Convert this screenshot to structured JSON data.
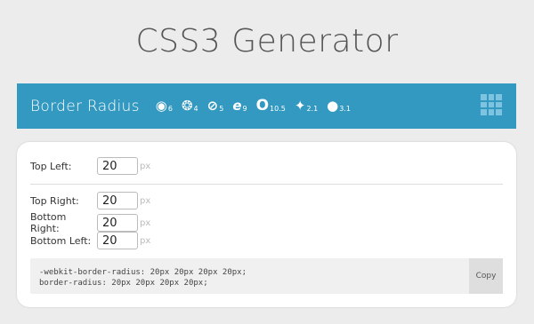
{
  "page": {
    "title": "CSS3 Generator"
  },
  "header": {
    "title": "Border Radius",
    "browsers": [
      {
        "icon": "chrome-icon",
        "glyph": "◉",
        "version": "6"
      },
      {
        "icon": "firefox-icon",
        "glyph": "❂",
        "version": "4"
      },
      {
        "icon": "safari-icon",
        "glyph": "⊘",
        "version": "5"
      },
      {
        "icon": "ie-icon",
        "glyph": "e",
        "version": "9"
      },
      {
        "icon": "opera-icon",
        "glyph": "O",
        "version": "10.5"
      },
      {
        "icon": "android-icon",
        "glyph": "✦",
        "version": "2.1"
      },
      {
        "icon": "apple-icon",
        "glyph": "●",
        "version": "3.1"
      }
    ]
  },
  "fields": {
    "top_left": {
      "label": "Top Left:",
      "value": "20",
      "unit": "px"
    },
    "top_right": {
      "label": "Top Right:",
      "value": "20",
      "unit": "px"
    },
    "bottom_right": {
      "label": "Bottom Right:",
      "value": "20",
      "unit": "px"
    },
    "bottom_left": {
      "label": "Bottom Left:",
      "value": "20",
      "unit": "px"
    }
  },
  "output": {
    "line1": "-webkit-border-radius: 20px 20px 20px 20px;",
    "line2": "border-radius: 20px 20px 20px 20px;",
    "copy_label": "Copy"
  },
  "colors": {
    "accent": "#3399c1",
    "background": "#ececec"
  }
}
